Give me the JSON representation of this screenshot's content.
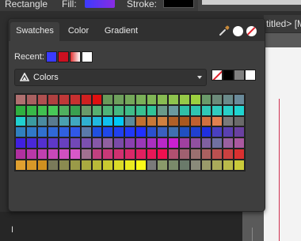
{
  "context_toolbar": {
    "shape_label": "Rectangle",
    "fill_label": "Fill:",
    "stroke_label": "Stroke:"
  },
  "document_tab": {
    "title": "titled> [M"
  },
  "panel": {
    "tabs": [
      {
        "label": "Swatches",
        "active": true
      },
      {
        "label": "Color",
        "active": false
      },
      {
        "label": "Gradient",
        "active": false
      }
    ],
    "icons": [
      "eyedropper-icon",
      "white-circle-icon",
      "none-swatch-icon"
    ],
    "recent_label": "Recent:",
    "recent_colors": [
      "#3a3aff",
      "#cc1020",
      "#e03030",
      "#ffffff"
    ],
    "palette": {
      "selected": "Colors"
    },
    "quick_colors": [
      "none",
      "#000000",
      "#808080",
      "#ffffff"
    ],
    "swatch_grid": [
      [
        "#b07070",
        "#a86060",
        "#b05050",
        "#b04040",
        "#c03838",
        "#c83030",
        "#d02020",
        "#e01010",
        "#6a9a5a",
        "#6ea05c",
        "#74a85a",
        "#7ab058",
        "#80b656",
        "#88bc52",
        "#8ec44e",
        "#96ca48",
        "#9cd040",
        "#6a9a6a",
        "#6c8a7a",
        "#6a8a8a",
        "#6a8a9a"
      ],
      [
        "#30b040",
        "#38b848",
        "#40c050",
        "#48c858",
        "#50b060",
        "#3aa050",
        "#6a9a6a",
        "#58b070",
        "#50b478",
        "#48b880",
        "#40bc88",
        "#38c090",
        "#30c498",
        "#6a9a8a",
        "#6a9aa0",
        "#30c0a8",
        "#30c4b0",
        "#30c8b8",
        "#30ccc0",
        "#28d0c8",
        "#20d4d0"
      ],
      [
        "#20d0d0",
        "#3a9aa0",
        "#4a8aa0",
        "#5a7a90",
        "#4aa0b0",
        "#40a8c0",
        "#30b0d0",
        "#20b8e0",
        "#10c0f0",
        "#00c8f8",
        "#5a8a9a",
        "#c07030",
        "#c87838",
        "#d08040",
        "#b06028",
        "#a85820",
        "#c06030",
        "#d07040",
        "#e08050",
        "#7a7a7a",
        "#6a6a6a"
      ],
      [
        "#3080c0",
        "#3078c8",
        "#3070d0",
        "#3068d8",
        "#3060e0",
        "#3058e8",
        "#5a7aaa",
        "#2050e0",
        "#2048e8",
        "#2040f0",
        "#2038f8",
        "#2030ff",
        "#2a50d0",
        "#3a60c0",
        "#4070b0",
        "#2050c0",
        "#2040d0",
        "#2030e0",
        "#4a40c0",
        "#5a40b0",
        "#6a40a0"
      ],
      [
        "#4020e0",
        "#4a28d8",
        "#5430d0",
        "#5e38c8",
        "#6840c0",
        "#7248b8",
        "#7c50b0",
        "#8658a8",
        "#9060a0",
        "#7a4aa8",
        "#8a40b0",
        "#9a38b8",
        "#aa30c0",
        "#ba28c8",
        "#ca20d0",
        "#a040a0",
        "#9050a0",
        "#8060a0",
        "#7070a0",
        "#9a60a0",
        "#aa58a0"
      ],
      [
        "#b030a0",
        "#b838a8",
        "#c040b0",
        "#c848b8",
        "#d050c0",
        "#d858c8",
        "#a07090",
        "#c04080",
        "#c83878",
        "#d03070",
        "#d82868",
        "#e02060",
        "#e81858",
        "#f01050",
        "#b05070",
        "#a06070",
        "#9a7070",
        "#aa6060",
        "#ba5050",
        "#ca4040",
        "#da3030"
      ],
      [
        "#e0a030",
        "#d89828",
        "#d09020",
        "#7a7a5a",
        "#8a8a50",
        "#9a9a48",
        "#aaaa40",
        "#baba38",
        "#caca30",
        "#dada28",
        "#eaea20",
        "#fafa18",
        "#7a7a7a",
        "#8a9a6a",
        "#7a8a6a",
        "#6a7a6a",
        "#8a8a7a",
        "#9a9a6a",
        "#aaaa5a",
        "#baba4a",
        "#caca3a"
      ]
    ]
  }
}
